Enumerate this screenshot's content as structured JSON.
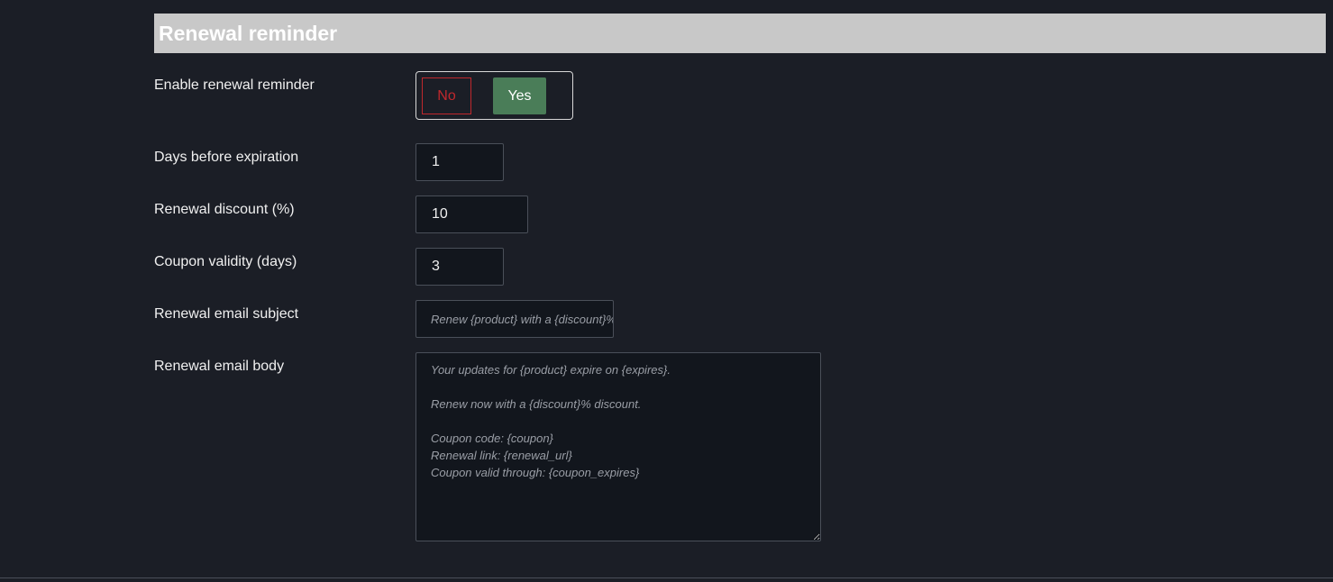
{
  "section": {
    "title": "Renewal reminder"
  },
  "enable_reminder": {
    "label": "Enable renewal reminder",
    "no_label": "No",
    "yes_label": "Yes",
    "selected": "Yes"
  },
  "days_before": {
    "label": "Days before expiration",
    "value": "1"
  },
  "discount": {
    "label": "Renewal discount (%)",
    "value": "10"
  },
  "coupon_validity": {
    "label": "Coupon validity (days)",
    "value": "3"
  },
  "email_subject": {
    "label": "Renewal email subject",
    "placeholder": "Renew {product} with a {discount}% discount"
  },
  "email_body": {
    "label": "Renewal email body",
    "placeholder": "Your updates for {product} expire on {expires}.\n\nRenew now with a {discount}% discount.\n\nCoupon code: {coupon}\nRenewal link: {renewal_url}\nCoupon valid through: {coupon_expires}"
  },
  "colors": {
    "background": "#1b1e26",
    "header_bg": "#c8c8c8",
    "no_red": "#c0282d",
    "yes_green": "#4a7d58"
  }
}
